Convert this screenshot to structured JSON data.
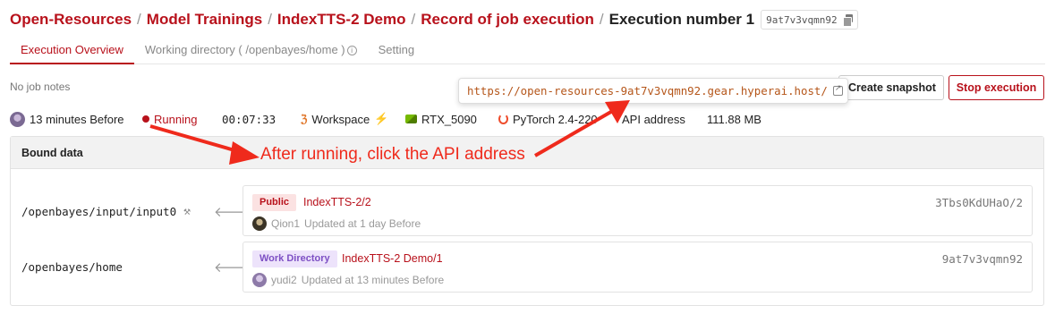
{
  "breadcrumb": {
    "items": [
      "Open-Resources",
      "Model Trainings",
      "IndexTTS-2 Demo",
      "Record of job execution"
    ],
    "separator": "/",
    "current": "Execution number 1",
    "job_id": "9at7v3vqmn92"
  },
  "tabs": [
    {
      "label": "Execution Overview",
      "active": true
    },
    {
      "label": "Working directory ( /openbayes/home )",
      "active": false
    },
    {
      "label": "Setting",
      "active": false
    }
  ],
  "notes": "No job notes",
  "api_popover": {
    "url": "https://open-resources-9at7v3vqmn92.gear.hyperai.host/"
  },
  "actions": {
    "snapshot_label": "Create snapshot",
    "stop_label": "Stop execution"
  },
  "status": {
    "started": "13 minutes Before",
    "state": "Running",
    "duration": "00:07:33",
    "workspace": "Workspace",
    "gpu": "RTX_5090",
    "framework": "PyTorch 2.4-220",
    "api_label": "API address",
    "size": "111.88 MB"
  },
  "bound_data": {
    "title": "Bound data",
    "rows": [
      {
        "mount": "/openbayes/input/input0",
        "tag": "Public",
        "name": "IndexTTS-2/2",
        "id": "3Tbs0KdUHaO/2",
        "user": "Qion1",
        "updated": "Updated at 1 day Before"
      },
      {
        "mount": "/openbayes/home",
        "tag": "Work Directory",
        "name": "IndexTTS-2 Demo/1",
        "id": "9at7v3vqmn92",
        "user": "yudi2",
        "updated": "Updated at 13 minutes Before"
      }
    ]
  },
  "annotation": {
    "text": "After running, click the API address",
    "color": "#ef2a1c"
  },
  "colors": {
    "brand": "#b8111b",
    "url": "#b5561a",
    "workdir_tag": "#7d4fc4"
  }
}
